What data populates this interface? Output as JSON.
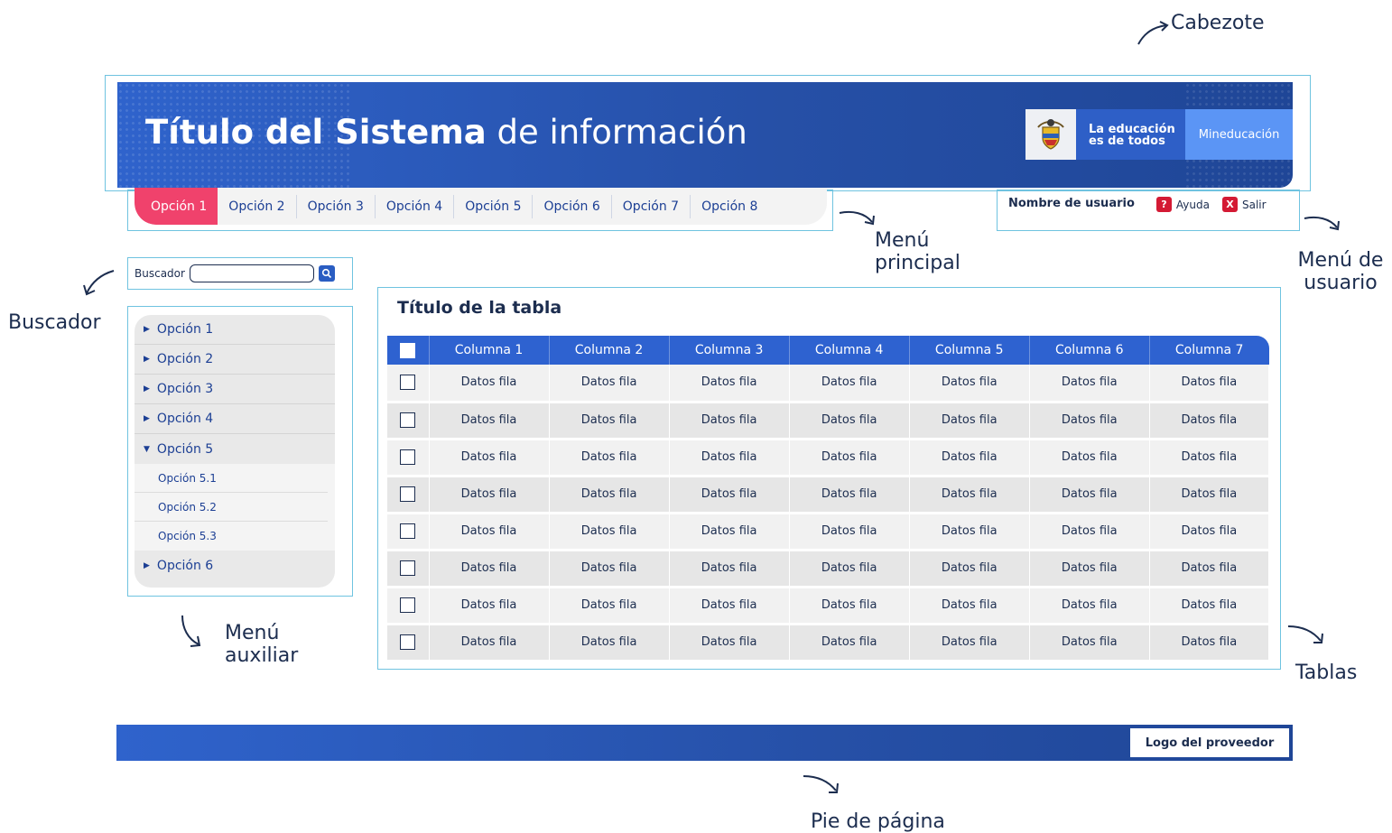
{
  "annotations": {
    "cabezote": "Cabezote",
    "menu_principal": [
      "Menú",
      "principal"
    ],
    "menu_usuario": [
      "Menú de",
      "usuario"
    ],
    "buscador": "Buscador",
    "menu_auxiliar": [
      "Menú",
      "auxiliar"
    ],
    "tablas": "Tablas",
    "pie": "Pie de página"
  },
  "header": {
    "title_bold": "Título del Sistema",
    "title_light": " de información",
    "edu_line1": "La educación",
    "edu_line2": "es de todos",
    "ministry": "Mineducación"
  },
  "main_menu": [
    "Opción 1",
    "Opción 2",
    "Opción 3",
    "Opción 4",
    "Opción 5",
    "Opción 6",
    "Opción 7",
    "Opción 8"
  ],
  "user_menu": {
    "username": "Nombre de usuario",
    "help": "Ayuda",
    "help_icon": "?",
    "logout": "Salir",
    "logout_icon": "X"
  },
  "search": {
    "label": "Buscador",
    "value": ""
  },
  "aux_menu": {
    "items": [
      "Opción 1",
      "Opción 2",
      "Opción 3",
      "Opción 4",
      "Opción 5"
    ],
    "subitems": [
      "Opción 5.1",
      "Opción 5.2",
      "Opción 5.3"
    ],
    "last": "Opción 6"
  },
  "table": {
    "title": "Título de la tabla",
    "columns": [
      "Columna 1",
      "Columna 2",
      "Columna 3",
      "Columna 4",
      "Columna 5",
      "Columna 6",
      "Columna 7"
    ],
    "rows": [
      [
        "Datos fila",
        "Datos fila",
        "Datos fila",
        "Datos fila",
        "Datos fila",
        "Datos fila",
        "Datos fila"
      ],
      [
        "Datos fila",
        "Datos fila",
        "Datos fila",
        "Datos fila",
        "Datos fila",
        "Datos fila",
        "Datos fila"
      ],
      [
        "Datos fila",
        "Datos fila",
        "Datos fila",
        "Datos fila",
        "Datos fila",
        "Datos fila",
        "Datos fila"
      ],
      [
        "Datos fila",
        "Datos fila",
        "Datos fila",
        "Datos fila",
        "Datos fila",
        "Datos fila",
        "Datos fila"
      ],
      [
        "Datos fila",
        "Datos fila",
        "Datos fila",
        "Datos fila",
        "Datos fila",
        "Datos fila",
        "Datos fila"
      ],
      [
        "Datos fila",
        "Datos fila",
        "Datos fila",
        "Datos fila",
        "Datos fila",
        "Datos fila",
        "Datos fila"
      ],
      [
        "Datos fila",
        "Datos fila",
        "Datos fila",
        "Datos fila",
        "Datos fila",
        "Datos fila",
        "Datos fila"
      ],
      [
        "Datos fila",
        "Datos fila",
        "Datos fila",
        "Datos fila",
        "Datos fila",
        "Datos fila",
        "Datos fila"
      ]
    ]
  },
  "footer": {
    "provider_logo": "Logo del proveedor"
  },
  "colors": {
    "primary": "#2e62d0",
    "active_tab": "#f0426c",
    "annotation_frame": "#6fc3e0",
    "danger": "#d41a34"
  }
}
